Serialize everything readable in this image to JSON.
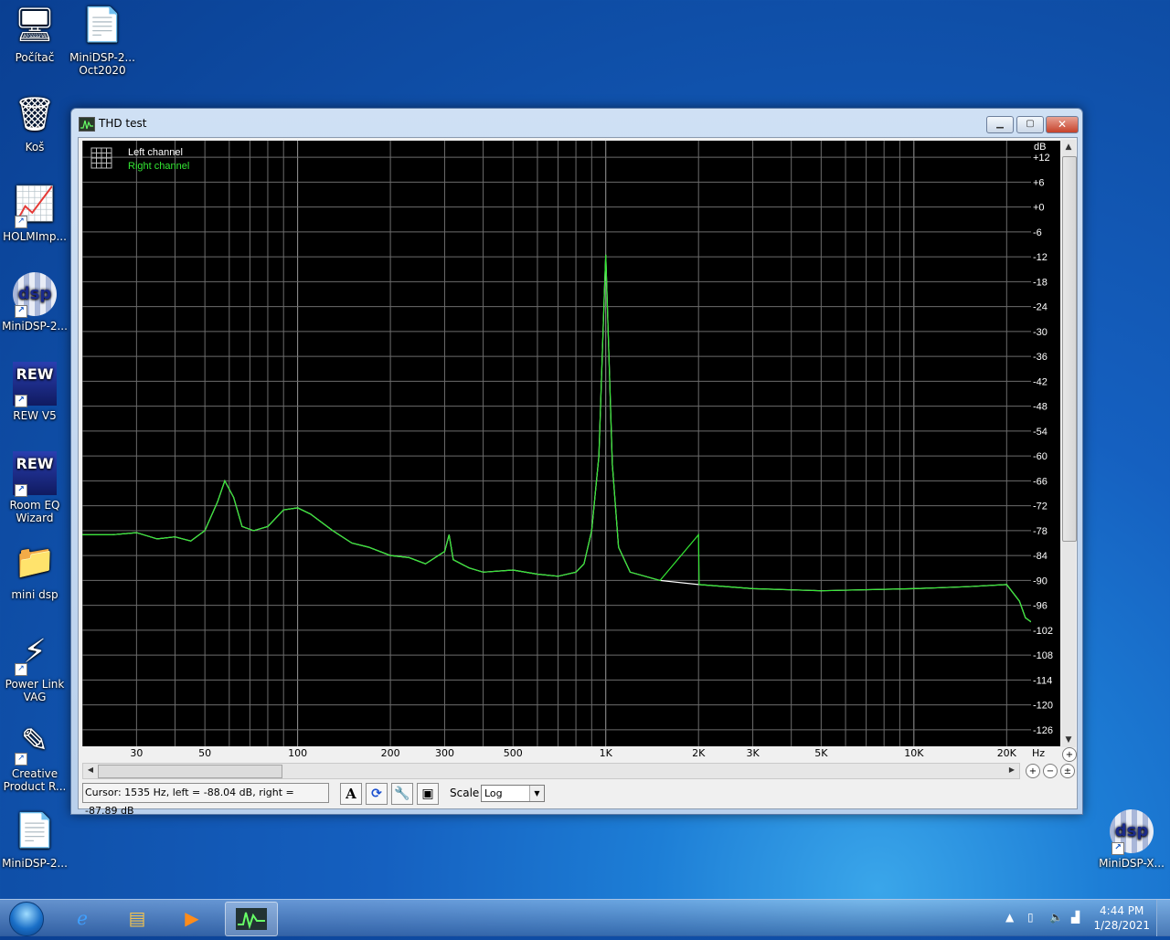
{
  "desktop": {
    "icons": [
      {
        "label": "Počítač",
        "glyph": "🖥"
      },
      {
        "label": "MiniDSP-2...\nOct2020",
        "glyph": "📄"
      },
      {
        "label": "Koš",
        "glyph": "🗑"
      },
      {
        "label": "HOLMImp...",
        "glyph": "📈"
      },
      {
        "label": "MiniDSP-2...",
        "glyph": "dsp"
      },
      {
        "label": "REW V5",
        "glyph": "REW"
      },
      {
        "label": "Room EQ\nWizard",
        "glyph": "REW"
      },
      {
        "label": "mini dsp",
        "glyph": "📁"
      },
      {
        "label": "Power Link\nVAG",
        "glyph": "⚡"
      },
      {
        "label": "Creative\nProduct R...",
        "glyph": "✎"
      },
      {
        "label": "MiniDSP-2...",
        "glyph": "📄"
      },
      {
        "label": "MiniDSP-X...",
        "glyph": "dsp"
      }
    ]
  },
  "window": {
    "title": "THD test",
    "minimize_label": "▁",
    "maximize_label": "▢",
    "close_label": "✕"
  },
  "chart_data": {
    "type": "line",
    "title": "",
    "xlabel": "Hz",
    "ylabel": "dB",
    "x_scale": "log",
    "xlim": [
      20,
      24000
    ],
    "ylim": [
      -130,
      16
    ],
    "x_ticks": [
      30,
      50,
      100,
      200,
      300,
      500,
      1000,
      2000,
      3000,
      5000,
      10000,
      20000
    ],
    "x_tick_labels": [
      "30",
      "50",
      "100",
      "200",
      "300",
      "500",
      "1K",
      "2K",
      "3K",
      "5K",
      "10K",
      "20K"
    ],
    "y_ticks": [
      12,
      6,
      0,
      -6,
      -12,
      -18,
      -24,
      -30,
      -36,
      -42,
      -48,
      -54,
      -60,
      -66,
      -72,
      -78,
      -84,
      -90,
      -96,
      -102,
      -108,
      -114,
      -120,
      -126
    ],
    "y_tick_labels": [
      "+12",
      "+6",
      "+0",
      "-6",
      "-12",
      "-18",
      "-24",
      "-30",
      "-36",
      "-42",
      "-48",
      "-54",
      "-60",
      "-66",
      "-72",
      "-78",
      "-84",
      "-90",
      "-96",
      "-102",
      "-108",
      "-114",
      "-120",
      "-126"
    ],
    "grid": true,
    "legend": "top-left",
    "series": [
      {
        "name": "Left channel",
        "color": "#ffffff",
        "points": [
          [
            20,
            -79
          ],
          [
            25,
            -79
          ],
          [
            30,
            -78.5
          ],
          [
            35,
            -80
          ],
          [
            40,
            -79.5
          ],
          [
            45,
            -80.5
          ],
          [
            50,
            -78
          ],
          [
            55,
            -71
          ],
          [
            58,
            -66
          ],
          [
            62,
            -70
          ],
          [
            66,
            -77
          ],
          [
            72,
            -78
          ],
          [
            80,
            -77
          ],
          [
            90,
            -73
          ],
          [
            100,
            -72.5
          ],
          [
            110,
            -74
          ],
          [
            130,
            -78
          ],
          [
            150,
            -81
          ],
          [
            170,
            -82
          ],
          [
            200,
            -84
          ],
          [
            230,
            -84.5
          ],
          [
            260,
            -86
          ],
          [
            300,
            -83
          ],
          [
            310,
            -79
          ],
          [
            320,
            -85
          ],
          [
            360,
            -87
          ],
          [
            400,
            -88
          ],
          [
            500,
            -87.5
          ],
          [
            600,
            -88.5
          ],
          [
            700,
            -89
          ],
          [
            800,
            -88
          ],
          [
            850,
            -86
          ],
          [
            900,
            -78
          ],
          [
            950,
            -60
          ],
          [
            990,
            -20
          ],
          [
            1000,
            -11.5
          ],
          [
            1010,
            -22
          ],
          [
            1050,
            -62
          ],
          [
            1100,
            -82
          ],
          [
            1200,
            -88
          ],
          [
            1500,
            -90
          ],
          [
            2000,
            -91
          ],
          [
            3000,
            -92
          ],
          [
            5000,
            -92.5
          ],
          [
            10000,
            -92
          ],
          [
            15000,
            -91.5
          ],
          [
            20000,
            -91
          ],
          [
            22000,
            -95
          ],
          [
            23000,
            -99
          ],
          [
            24000,
            -100
          ]
        ]
      },
      {
        "name": "Right channel",
        "color": "#33e633",
        "points": [
          [
            20,
            -79
          ],
          [
            25,
            -79
          ],
          [
            30,
            -78.5
          ],
          [
            35,
            -80
          ],
          [
            40,
            -79.5
          ],
          [
            45,
            -80.5
          ],
          [
            50,
            -78
          ],
          [
            55,
            -71
          ],
          [
            58,
            -66
          ],
          [
            62,
            -70
          ],
          [
            66,
            -77
          ],
          [
            72,
            -78
          ],
          [
            80,
            -77
          ],
          [
            90,
            -73
          ],
          [
            100,
            -72.5
          ],
          [
            110,
            -74
          ],
          [
            130,
            -78
          ],
          [
            150,
            -81
          ],
          [
            170,
            -82
          ],
          [
            200,
            -84
          ],
          [
            230,
            -84.5
          ],
          [
            260,
            -86
          ],
          [
            300,
            -83
          ],
          [
            310,
            -79
          ],
          [
            320,
            -85
          ],
          [
            360,
            -87
          ],
          [
            400,
            -88
          ],
          [
            500,
            -87.5
          ],
          [
            600,
            -88.5
          ],
          [
            700,
            -89
          ],
          [
            800,
            -88
          ],
          [
            850,
            -86
          ],
          [
            900,
            -78
          ],
          [
            950,
            -60
          ],
          [
            990,
            -20
          ],
          [
            1000,
            -11.5
          ],
          [
            1010,
            -22
          ],
          [
            1050,
            -62
          ],
          [
            1100,
            -82
          ],
          [
            1200,
            -88
          ],
          [
            1500,
            -90
          ],
          [
            2000,
            -79
          ],
          [
            2010,
            -91
          ],
          [
            3000,
            -92
          ],
          [
            5000,
            -92.5
          ],
          [
            10000,
            -92
          ],
          [
            15000,
            -91.5
          ],
          [
            20000,
            -91
          ],
          [
            22000,
            -95
          ],
          [
            23000,
            -99
          ],
          [
            24000,
            -100
          ]
        ]
      }
    ]
  },
  "legend": {
    "left": "Left channel",
    "right": "Right channel"
  },
  "axis": {
    "y_unit": "dB",
    "x_unit": "Hz"
  },
  "status": {
    "cursor_text": "Cursor:  1535 Hz,  left = -88.04 dB,  right = -87.89 dB",
    "scale_label": "Scale",
    "scale_value": "Log",
    "tool_a": "A"
  },
  "taskbar": {
    "time": "4:44 PM",
    "date": "1/28/2021"
  }
}
